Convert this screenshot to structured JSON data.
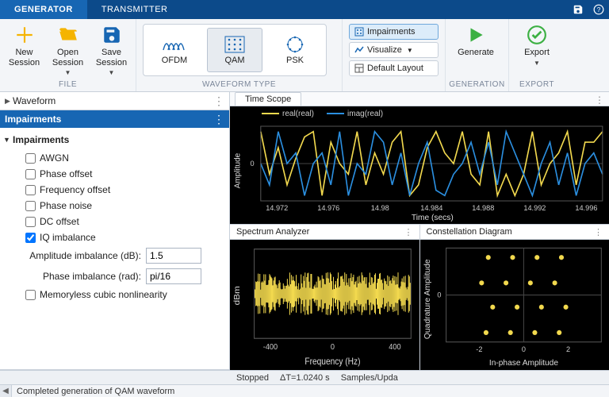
{
  "tabs": {
    "generator": "GENERATOR",
    "transmitter": "TRANSMITTER"
  },
  "ribbon": {
    "file": {
      "label": "FILE",
      "new": "New\nSession",
      "open": "Open\nSession",
      "save": "Save\nSession"
    },
    "waveform": {
      "label": "WAVEFORM TYPE",
      "ofdm": "OFDM",
      "qam": "QAM",
      "psk": "PSK"
    },
    "display": {
      "impairments": "Impairments",
      "visualize": "Visualize",
      "default_layout": "Default Layout"
    },
    "generation": {
      "label": "GENERATION",
      "generate": "Generate"
    },
    "export": {
      "label": "EXPORT",
      "export": "Export"
    }
  },
  "left": {
    "waveform_header": "Waveform",
    "impairments_header": "Impairments",
    "impairments_sub": "Impairments",
    "checks": {
      "awgn": "AWGN",
      "phase_offset": "Phase offset",
      "frequency_offset": "Frequency offset",
      "phase_noise": "Phase noise",
      "dc_offset": "DC offset",
      "iq_imbalance": "IQ imbalance",
      "memoryless": "Memoryless cubic nonlinearity"
    },
    "amp_label": "Amplitude imbalance (dB):",
    "amp_value": "1.5",
    "phase_label": "Phase imbalance (rad):",
    "phase_value": "pi/16"
  },
  "time_scope": {
    "tab": "Time Scope",
    "legend_real": "real(real)",
    "legend_imag": "imag(real)",
    "ylabel": "Amplitude",
    "xlabel": "Time (secs)",
    "yticks": [
      "0"
    ],
    "xticks": [
      "14.972",
      "14.976",
      "14.98",
      "14.984",
      "14.988",
      "14.992",
      "14.996"
    ]
  },
  "spectrum": {
    "title": "Spectrum Analyzer",
    "ylabel": "dBm",
    "xlabel": "Frequency (Hz)",
    "xticks": [
      "-400",
      "0",
      "400"
    ]
  },
  "constellation": {
    "title": "Constellation Diagram",
    "ylabel": "Quadrature Amplitude",
    "xlabel": "In-phase Amplitude",
    "xticks": [
      "-2",
      "0",
      "2"
    ],
    "yticks": [
      "0"
    ]
  },
  "status": {
    "stopped": "Stopped",
    "dt": "ΔT=1.0240 s",
    "samples": "Samples/Upda"
  },
  "footer_msg": "Completed generation of QAM waveform",
  "colors": {
    "real": "#f2d94e",
    "imag": "#2b8fe0",
    "grid": "#444"
  },
  "chart_data": [
    {
      "type": "line",
      "title": "Time Scope",
      "xlabel": "Time (secs)",
      "ylabel": "Amplitude",
      "x_ticks": [
        14.972,
        14.976,
        14.98,
        14.984,
        14.988,
        14.992,
        14.996
      ],
      "ylim": [
        -3.5,
        3.5
      ],
      "series": [
        {
          "name": "real(real)",
          "color": "#f2d94e",
          "y": [
            3,
            -1,
            1.5,
            -2,
            0.5,
            2.5,
            3,
            -3,
            2,
            0,
            -1,
            3,
            -2,
            1,
            -1,
            2,
            3,
            -3,
            -2,
            1.5,
            3,
            1,
            0,
            3,
            -1,
            -2,
            3,
            -3,
            -1,
            -3,
            -1,
            3,
            -2,
            0,
            1,
            3,
            -2,
            2,
            2,
            3
          ]
        },
        {
          "name": "imag(real)",
          "color": "#2b8fe0",
          "y": [
            0,
            -2,
            3,
            0,
            1,
            -3,
            0,
            1,
            -2,
            3,
            -3,
            0,
            -1,
            3,
            2,
            -2,
            1,
            -3,
            0,
            2,
            -2.5,
            -3,
            -1,
            0,
            2,
            -1,
            2,
            -2,
            3,
            1,
            -1,
            -3,
            0,
            2,
            -2,
            1,
            -3,
            0,
            1,
            -1
          ]
        }
      ]
    },
    {
      "type": "line",
      "title": "Spectrum Analyzer",
      "xlabel": "Frequency (Hz)",
      "ylabel": "dBm",
      "xlim": [
        -500,
        500
      ],
      "x_ticks": [
        -400,
        0,
        400
      ],
      "note": "dense noisy spectrum; values not individually readable"
    },
    {
      "type": "scatter",
      "title": "Constellation Diagram",
      "xlabel": "In-phase Amplitude",
      "ylabel": "Quadrature Amplitude",
      "xlim": [
        -3.5,
        3.5
      ],
      "ylim": [
        -3.5,
        3.5
      ],
      "points": [
        [
          -1.6,
          2.8
        ],
        [
          -0.5,
          2.8
        ],
        [
          0.6,
          2.8
        ],
        [
          1.7,
          2.8
        ],
        [
          -1.9,
          0.9
        ],
        [
          -0.8,
          0.9
        ],
        [
          0.3,
          0.9
        ],
        [
          1.4,
          0.9
        ],
        [
          -1.4,
          -0.9
        ],
        [
          -0.3,
          -0.9
        ],
        [
          0.8,
          -0.9
        ],
        [
          1.9,
          -0.9
        ],
        [
          -1.7,
          -2.8
        ],
        [
          -0.6,
          -2.8
        ],
        [
          0.5,
          -2.8
        ],
        [
          1.6,
          -2.8
        ]
      ]
    }
  ]
}
